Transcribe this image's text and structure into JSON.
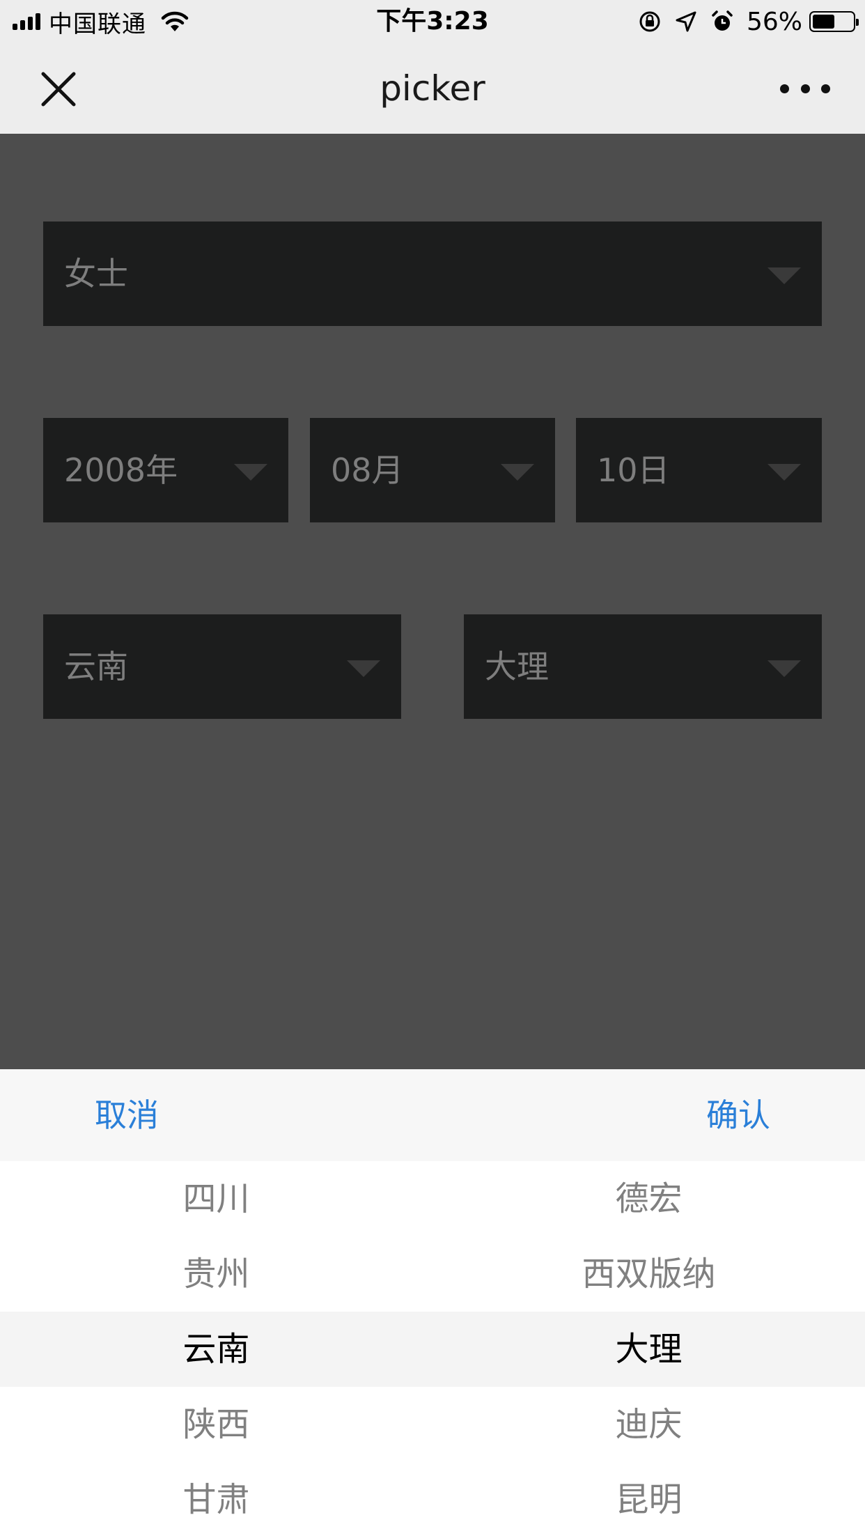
{
  "status_bar": {
    "carrier": "中国联通",
    "time": "下午3:23",
    "battery_percent": "56%",
    "battery_level": 0.56
  },
  "nav": {
    "title": "picker"
  },
  "form": {
    "gender": "女士",
    "year": "2008年",
    "month": "08月",
    "day": "10日",
    "province": "云南",
    "city": "大理"
  },
  "sheet": {
    "cancel_label": "取消",
    "confirm_label": "确认",
    "provinces": [
      "四川",
      "贵州",
      "云南",
      "陕西",
      "甘肃"
    ],
    "cities": [
      "德宏",
      "西双版纳",
      "大理",
      "迪庆",
      "昆明"
    ],
    "selected_index": 2
  },
  "colors": {
    "accent": "#2a7fd8",
    "overlay_bg": "#4d4d4d",
    "field_bg": "#1c1d1d",
    "bar_bg": "#ededed"
  }
}
